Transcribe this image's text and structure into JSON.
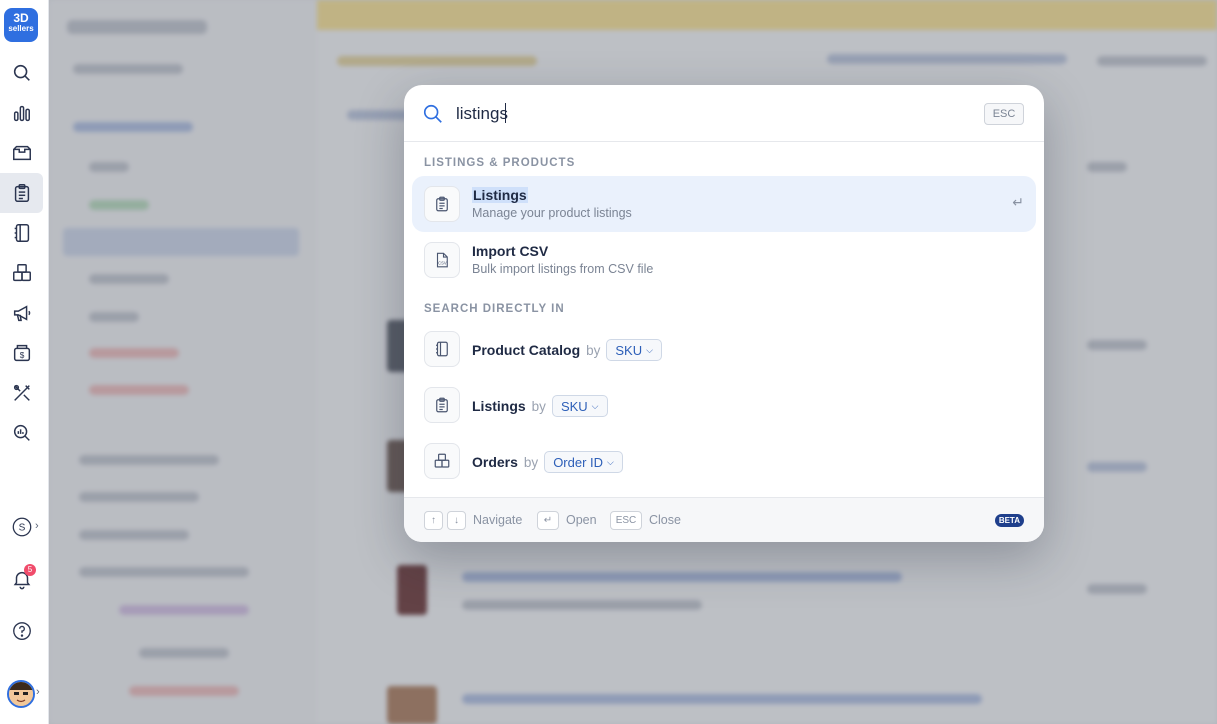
{
  "rail": {
    "logo_line1": "3D",
    "logo_line2": "sellers",
    "items": [
      {
        "icon": "search-icon"
      },
      {
        "icon": "bar-chart-icon"
      },
      {
        "icon": "inbox-icon"
      },
      {
        "icon": "clipboard-list-icon",
        "active": true
      },
      {
        "icon": "notebook-icon"
      },
      {
        "icon": "boxes-icon"
      },
      {
        "icon": "megaphone-icon"
      },
      {
        "icon": "money-box-icon"
      },
      {
        "icon": "tools-icon"
      },
      {
        "icon": "analytics-search-icon"
      }
    ],
    "store_initial": "S",
    "notifications_count": "5",
    "help_icon": "help-circle-icon"
  },
  "palette": {
    "query": "listings",
    "esc_label": "ESC",
    "section_results": "LISTINGS & PRODUCTS",
    "results": [
      {
        "title": "Listings",
        "subtitle": "Manage your product listings",
        "icon": "clipboard-list-icon",
        "selected": true
      },
      {
        "title": "Import CSV",
        "subtitle": "Bulk import listings from CSV file",
        "icon": "csv-file-icon",
        "selected": false
      }
    ],
    "section_search": "SEARCH DIRECTLY IN",
    "by_label": "by",
    "search_in": [
      {
        "title": "Product Catalog",
        "field": "SKU",
        "icon": "notebook-icon"
      },
      {
        "title": "Listings",
        "field": "SKU",
        "icon": "clipboard-list-icon"
      },
      {
        "title": "Orders",
        "field": "Order ID",
        "icon": "boxes-icon"
      }
    ],
    "footer": {
      "navigate_label": "Navigate",
      "open_label": "Open",
      "esc_key": "ESC",
      "close_label": "Close",
      "beta_label": "BETA"
    }
  },
  "colors": {
    "accent": "#2f6fe0",
    "selected_row": "#eaf1fc",
    "badge": "#f04c6b",
    "chip_text": "#2d5fb8"
  }
}
